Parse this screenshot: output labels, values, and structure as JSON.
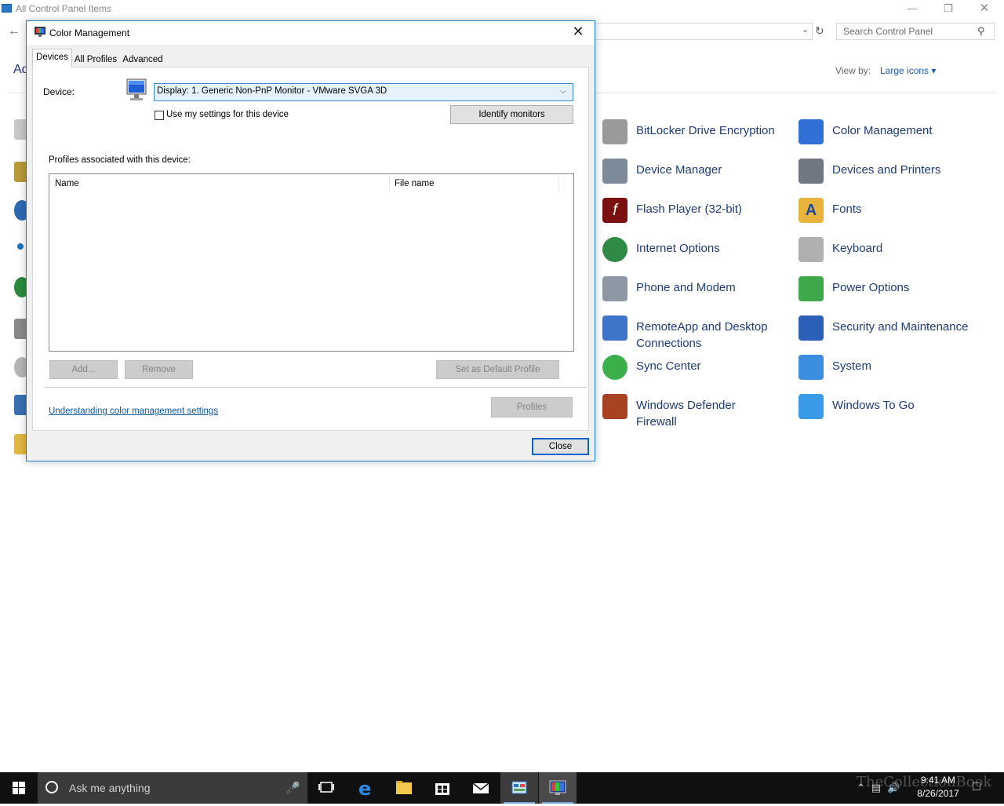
{
  "control_panel": {
    "title": "All Control Panel Items",
    "search_placeholder": "Search Control Panel",
    "adjust_fragment": "Ad",
    "view_by_label": "View by:",
    "view_by_value": "Large icons ▾",
    "items": [
      {
        "label": "BitLocker Drive Encryption",
        "icon": "bitlocker-icon"
      },
      {
        "label": "Color Management",
        "icon": "color-management-icon"
      },
      {
        "label": "Device Manager",
        "icon": "device-manager-icon"
      },
      {
        "label": "Devices and Printers",
        "icon": "devices-printers-icon"
      },
      {
        "label": "Flash Player (32-bit)",
        "icon": "flash-player-icon"
      },
      {
        "label": "Fonts",
        "icon": "fonts-icon"
      },
      {
        "label": "Internet Options",
        "icon": "internet-options-icon"
      },
      {
        "label": "Keyboard",
        "icon": "keyboard-icon"
      },
      {
        "label": "Phone and Modem",
        "icon": "phone-modem-icon"
      },
      {
        "label": "Power Options",
        "icon": "power-options-icon"
      },
      {
        "label": "RemoteApp and Desktop\nConnections",
        "icon": "remoteapp-icon"
      },
      {
        "label": "Security and Maintenance",
        "icon": "security-flag-icon"
      },
      {
        "label": "Sync Center",
        "icon": "sync-center-icon"
      },
      {
        "label": "System",
        "icon": "system-icon"
      },
      {
        "label": "Windows Defender\nFirewall",
        "icon": "firewall-icon"
      },
      {
        "label": "Windows To Go",
        "icon": "windows-to-go-icon"
      }
    ]
  },
  "dialog": {
    "title": "Color Management",
    "tabs": [
      {
        "label": "Devices",
        "selected": true
      },
      {
        "label": "All Profiles",
        "selected": false
      },
      {
        "label": "Advanced",
        "selected": false
      }
    ],
    "device_label": "Device:",
    "device_value": "Display: 1. Generic Non-PnP Monitor - VMware SVGA 3D",
    "use_settings_label": "Use my settings for this device",
    "use_settings_checked": false,
    "identify_label": "Identify monitors",
    "profiles_assoc_label": "Profiles associated with this device:",
    "columns": [
      "Name",
      "File name"
    ],
    "add_label": "Add...",
    "remove_label": "Remove",
    "set_default_label": "Set as Default Profile",
    "link_label": "Understanding color management settings",
    "profiles_label": "Profiles",
    "close_label": "Close"
  },
  "taskbar": {
    "search_placeholder": "Ask me anything",
    "time": "9:41 AM",
    "date": "8/26/2017",
    "watermark": "TheCollectionBook"
  },
  "colors": {
    "accent": "#1979ca",
    "link": "#1e3c78",
    "taskbar": "#101010"
  }
}
